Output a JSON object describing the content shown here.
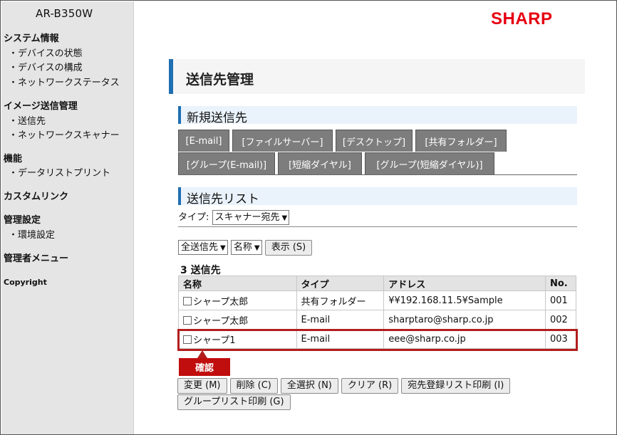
{
  "sidebar": {
    "model": "AR-B350W",
    "sections": [
      {
        "title": "システム情報",
        "items": [
          "・デバイスの状態",
          "・デバイスの構成",
          "・ネットワークステータス"
        ]
      },
      {
        "title": "イメージ送信管理",
        "items": [
          "・送信先",
          "・ネットワークスキャナー"
        ]
      },
      {
        "title": "機能",
        "items": [
          "・データリストプリント"
        ]
      },
      {
        "title": "カスタムリンク",
        "items": []
      },
      {
        "title": "管理設定",
        "items": [
          "・環境設定"
        ]
      },
      {
        "title": "管理者メニュー",
        "items": []
      }
    ],
    "copyright": "Copyright"
  },
  "brand": {
    "logo": "SHARP",
    "color": "#e60012"
  },
  "page_title": "送信先管理",
  "new_dest": {
    "title": "新規送信先",
    "tabs_row1": [
      "[E-mail]",
      "[ファイルサーバー]",
      "[デスクトップ]",
      "[共有フォルダー]"
    ],
    "tabs_row2": [
      "[グループ(E-mail)]",
      "[短縮ダイヤル]",
      "[グループ(短縮ダイヤル)]"
    ]
  },
  "dest_list": {
    "title": "送信先リスト",
    "type_label": "タイプ:",
    "type_value": "スキャナー宛先",
    "filter1": "全送信先",
    "filter2": "名称",
    "show_button": "表示 (S)",
    "count": "3 送信先",
    "columns": [
      "名称",
      "タイプ",
      "アドレス",
      "No."
    ],
    "rows": [
      {
        "name": "シャープ太郎",
        "type": "共有フォルダー",
        "address": "¥¥192.168.11.5¥Sample",
        "no": "001"
      },
      {
        "name": "シャープ太郎",
        "type": "E-mail",
        "address": "sharptaro@sharp.co.jp",
        "no": "002"
      },
      {
        "name": "シャープ1",
        "type": "E-mail",
        "address": "eee@sharp.co.jp",
        "no": "003"
      }
    ]
  },
  "confirm_label": "確認",
  "accent_red": "#b21e1e",
  "accent_blue": "#1f6fb3",
  "actions": {
    "change": "変更 (M)",
    "delete": "削除 (C)",
    "select_all": "全選択 (N)",
    "clear": "クリア (R)",
    "print_dest": "宛先登録リスト印刷 (I)",
    "print_group": "グループリスト印刷 (G)"
  }
}
